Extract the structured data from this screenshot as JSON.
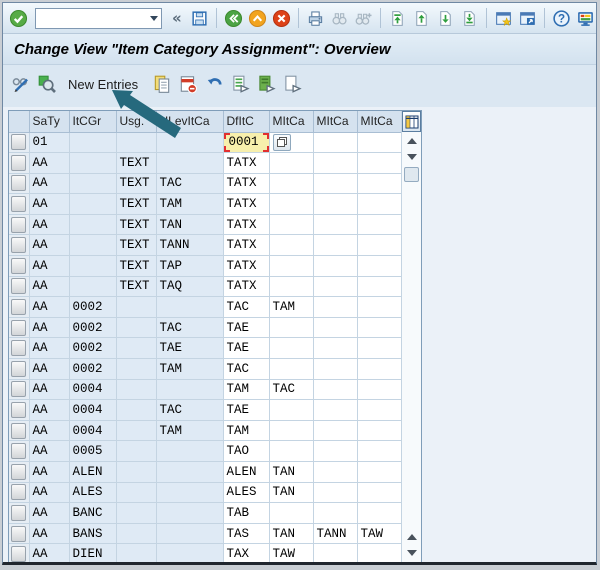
{
  "window": {
    "title": "Change View \"Item Category Assignment\": Overview"
  },
  "system_toolbar": {
    "command_field": {
      "value": ""
    },
    "icons": [
      "enter",
      "command-field",
      "collapse",
      "save",
      "back",
      "exit",
      "cancel",
      "print",
      "find",
      "find-next",
      "first-page",
      "page-up",
      "page-down",
      "last-page",
      "new-session",
      "create-shortcut",
      "help",
      "customize-layout"
    ]
  },
  "glyphs": {
    "collapse": "«",
    "help": "?"
  },
  "app_toolbar": {
    "new_entries_label": "New Entries",
    "icons": [
      "display-change",
      "choose",
      "copy",
      "delete-line",
      "undo",
      "select-all",
      "select-block",
      "deselect-all"
    ]
  },
  "annotation": {
    "shape": "arrow",
    "color": "#26697d",
    "points_at": "New Entries"
  },
  "table": {
    "headers": [
      "SaTy",
      "ItCGr",
      "Usg.",
      "HLevItCa",
      "DfItC",
      "MItCa",
      "MItCa",
      "MItCa"
    ],
    "focused": {
      "row": 0,
      "col": 4
    },
    "rows": [
      [
        "01",
        "",
        "",
        "",
        "0001",
        "",
        "",
        ""
      ],
      [
        "AA",
        "",
        "TEXT",
        "",
        "TATX",
        "",
        "",
        ""
      ],
      [
        "AA",
        "",
        "TEXT",
        "TAC",
        "TATX",
        "",
        "",
        ""
      ],
      [
        "AA",
        "",
        "TEXT",
        "TAM",
        "TATX",
        "",
        "",
        ""
      ],
      [
        "AA",
        "",
        "TEXT",
        "TAN",
        "TATX",
        "",
        "",
        ""
      ],
      [
        "AA",
        "",
        "TEXT",
        "TANN",
        "TATX",
        "",
        "",
        ""
      ],
      [
        "AA",
        "",
        "TEXT",
        "TAP",
        "TATX",
        "",
        "",
        ""
      ],
      [
        "AA",
        "",
        "TEXT",
        "TAQ",
        "TATX",
        "",
        "",
        ""
      ],
      [
        "AA",
        "0002",
        "",
        "",
        "TAC",
        "TAM",
        "",
        ""
      ],
      [
        "AA",
        "0002",
        "",
        "TAC",
        "TAE",
        "",
        "",
        ""
      ],
      [
        "AA",
        "0002",
        "",
        "TAE",
        "TAE",
        "",
        "",
        ""
      ],
      [
        "AA",
        "0002",
        "",
        "TAM",
        "TAC",
        "",
        "",
        ""
      ],
      [
        "AA",
        "0004",
        "",
        "",
        "TAM",
        "TAC",
        "",
        ""
      ],
      [
        "AA",
        "0004",
        "",
        "TAC",
        "TAE",
        "",
        "",
        ""
      ],
      [
        "AA",
        "0004",
        "",
        "TAM",
        "TAM",
        "",
        "",
        ""
      ],
      [
        "AA",
        "0005",
        "",
        "",
        "TAO",
        "",
        "",
        ""
      ],
      [
        "AA",
        "ALEN",
        "",
        "",
        "ALEN",
        "TAN",
        "",
        ""
      ],
      [
        "AA",
        "ALES",
        "",
        "",
        "ALES",
        "TAN",
        "",
        ""
      ],
      [
        "AA",
        "BANC",
        "",
        "",
        "TAB",
        "",
        "",
        ""
      ],
      [
        "AA",
        "BANS",
        "",
        "",
        "TAS",
        "TAN",
        "TANN",
        "TAW"
      ],
      [
        "AA",
        "DIEN",
        "",
        "",
        "TAX",
        "TAW",
        "",
        ""
      ]
    ]
  },
  "colors": {
    "chrome_bg": "#dbe7f2",
    "content_bg": "#ebf1f8",
    "header_bg": "#d5e2ef",
    "cell_blue": "#dfeaf5",
    "cell_white": "#ffffff",
    "grid_line": "#c4d4e2",
    "focused_cell_bg": "#f7efac",
    "focus_marker": "#e22f2f",
    "annotation_teal": "#26697d"
  }
}
